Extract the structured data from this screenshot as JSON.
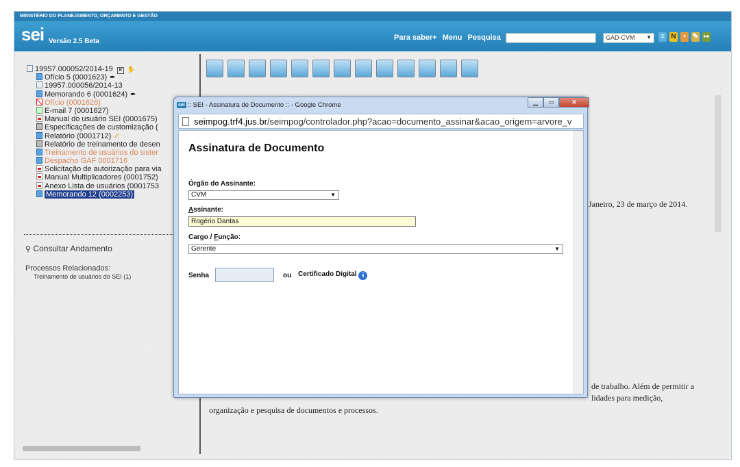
{
  "header": {
    "ministry": "MINISTÉRIO DO PLANEJAMENTO, ORÇAMENTO E GESTÃO",
    "logo": "sei",
    "version": "Versão 2.5 Beta",
    "links": [
      "Para saber+",
      "Menu",
      "Pesquisa"
    ],
    "unit": "GAD-CVM"
  },
  "tree": {
    "root": "19957.000052/2014-19",
    "items": [
      {
        "label": "Ofício 5 (0001623)",
        "icon": "doc",
        "pen": true
      },
      {
        "label": "19957.000056/2014-13",
        "icon": "proc"
      },
      {
        "label": "Memorando 6 (0001624)",
        "icon": "doc",
        "pen": true
      },
      {
        "label": "Ofício (0001626)",
        "icon": "cancel",
        "muted": true
      },
      {
        "label": "E-mail 7 (0001627)",
        "icon": "mail"
      },
      {
        "label": "Manual do usuário SEI (0001675)",
        "icon": "pdf"
      },
      {
        "label": "Especificações de customização (",
        "icon": "tbl"
      },
      {
        "label": "Relatório (0001712)",
        "icon": "doc"
      },
      {
        "label": "Relatório de treinamento de desen",
        "icon": "tbl"
      },
      {
        "label": "Treinamento de usuários do sister",
        "icon": "doc",
        "muted": true
      },
      {
        "label": "Despacho GAF 0001716",
        "icon": "doc",
        "muted": true
      },
      {
        "label": "Solicitação de autorização para via",
        "icon": "pdf"
      },
      {
        "label": "Manual Multiplicadores (0001752)",
        "icon": "pdf"
      },
      {
        "label": "Anexo Lista de usuários (0001753",
        "icon": "pdf"
      },
      {
        "label": "Memorando 12 (0002253)",
        "icon": "doc",
        "selected": true
      }
    ],
    "consult": "Consultar Andamento",
    "related_label": "Processos Relacionados:",
    "related_item": "Treinamento de usuários do SEI (1)"
  },
  "document": {
    "line1": "Janeiro, 23 de março de 2014.",
    "line2": "de trabalho. Além de permitir a",
    "line3": "lidades para medição,",
    "line4": "organização e pesquisa de documentos e processos."
  },
  "popup": {
    "window_title": ":: SEI - Assinatura de Documento :: - Google Chrome",
    "url_host": "seimpog.trf4.jus.br",
    "url_path": "/seimpog/controlador.php?acao=documento_assinar&acao_origem=arvore_v",
    "heading": "Assinatura de Documento",
    "orgao_label": "Órgão do Assinante:",
    "orgao_value": "CVM",
    "assinante_label_u": "A",
    "assinante_label_rest": "ssinante:",
    "assinante_value": "Rogério Dantas",
    "cargo_label_pre": "Cargo / ",
    "cargo_label_u": "F",
    "cargo_label_rest": "unção:",
    "cargo_value": "Gerente",
    "senha_label": "Senha",
    "ou_label": "ou",
    "cert_label": "Certificado Digital"
  }
}
